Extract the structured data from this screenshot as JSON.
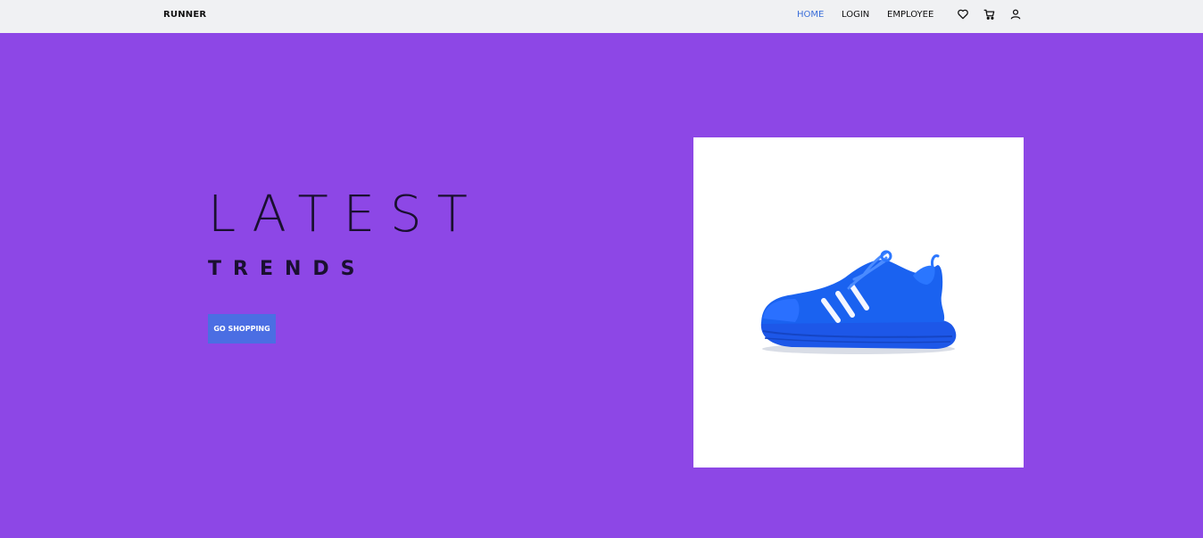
{
  "navbar": {
    "brand": "RUNNER",
    "links": [
      {
        "label": "HOME",
        "active": true
      },
      {
        "label": "LOGIN",
        "active": false
      },
      {
        "label": "EMPLOYEE",
        "active": false
      }
    ],
    "icons": [
      "heart-icon",
      "cart-icon",
      "user-icon"
    ],
    "active_color": "#3b6fd9"
  },
  "hero": {
    "title": "LATEST",
    "subtitle": "TRENDS",
    "cta_label": "GO SHOPPING",
    "background_color": "#8d47e6",
    "button_color": "#4b6ee3",
    "product_image": "blue-sneaker"
  }
}
